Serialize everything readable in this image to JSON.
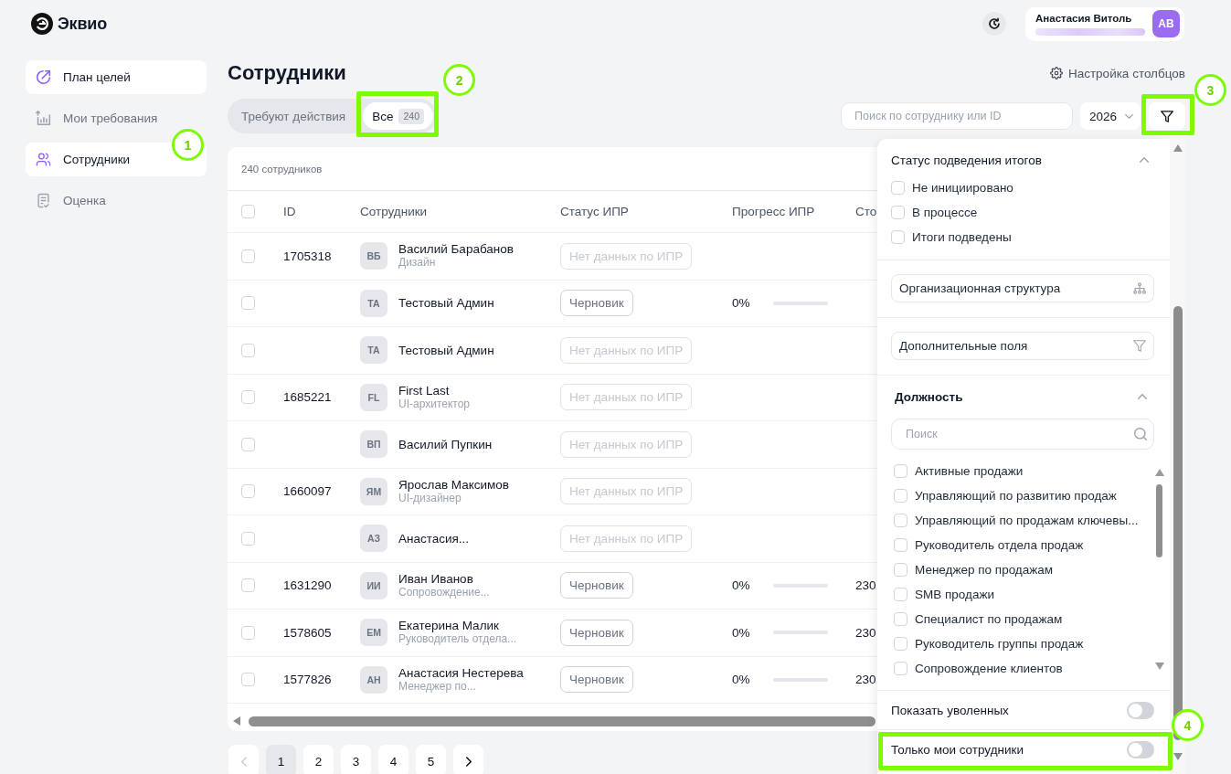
{
  "header": {
    "logo_text": "Эквио",
    "user": {
      "name": "Анастасия Витоль",
      "email_hidden": true,
      "initials": "АВ"
    }
  },
  "sidebar": {
    "items": [
      {
        "label": "План целей",
        "selected": true
      },
      {
        "label": "Мои требования",
        "selected": false
      },
      {
        "label": "Сотрудники",
        "selected": true,
        "marker": "1"
      },
      {
        "label": "Оценка",
        "selected": false
      }
    ]
  },
  "page": {
    "title": "Сотрудники",
    "columns_settings": "Настройка столбцов"
  },
  "tabs": [
    {
      "label": "Требуют действия",
      "selected": false,
      "highlighted": false
    },
    {
      "label": "Все",
      "count": "240",
      "selected": true,
      "highlighted": true,
      "marker": "2"
    }
  ],
  "search": {
    "placeholder": "Поиск по сотруднику или ID"
  },
  "year_select": {
    "value": "2026"
  },
  "filter_button": {
    "highlighted": true,
    "marker": "3"
  },
  "table": {
    "summary": "240 сотрудников",
    "select_all_checked": false,
    "columns": [
      "ID",
      "Сотрудники",
      "Статус ИПР",
      "Прогресс ИПР",
      "Сто"
    ],
    "rows": [
      {
        "checked": false,
        "id": "1705318",
        "initials": "ВБ",
        "name": "Василий Барабанов",
        "position": "Дизайн",
        "status": {
          "text": "Нет данных по ИПР",
          "kind": "empty"
        }
      },
      {
        "checked": false,
        "initials": "ТА",
        "name": "Тестовый Админ",
        "status": {
          "text": "Черновик",
          "kind": "draft"
        },
        "progress": {
          "text": "0%",
          "level": 0
        }
      },
      {
        "checked": false,
        "initials": "ТА",
        "name": "Тестовый Админ",
        "status": {
          "text": "Нет данных по ИПР",
          "kind": "empty"
        }
      },
      {
        "checked": false,
        "id": "1685221",
        "initials": "FL",
        "name": "First Last",
        "position": "UI-архитектор",
        "status": {
          "text": "Нет данных по ИПР",
          "kind": "empty"
        }
      },
      {
        "checked": false,
        "initials": "ВП",
        "name": "Василий Пупкин",
        "status": {
          "text": "Нет данных по ИПР",
          "kind": "empty"
        }
      },
      {
        "checked": false,
        "id": "1660097",
        "initials": "ЯМ",
        "name": "Ярослав Максимов",
        "position": "UI-дизайнер",
        "status": {
          "text": "Нет данных по ИПР",
          "kind": "empty"
        }
      },
      {
        "checked": false,
        "initials": "АЗ",
        "name": "Анастасия...",
        "status": {
          "text": "Нет данных по ИПР",
          "kind": "empty"
        }
      },
      {
        "checked": false,
        "id": "1631290",
        "initials": "ИИ",
        "name": "Иван Иванов",
        "position": "Сопровождение...",
        "status": {
          "text": "Черновик",
          "kind": "draft"
        },
        "progress": {
          "text": "0%",
          "level": 0
        },
        "column_5": "230"
      },
      {
        "checked": false,
        "id": "1578605",
        "initials": "ЕМ",
        "name": "Екатерина Малик",
        "position": "Руководитель отдела...",
        "status": {
          "text": "Черновик",
          "kind": "draft"
        },
        "progress": {
          "text": "0%",
          "level": 0
        },
        "column_5": "230"
      },
      {
        "checked": false,
        "id": "1577826",
        "initials": "АН",
        "name": "Анастасия Нестерева",
        "position": "Менеджер по...",
        "status": {
          "text": "Черновик",
          "kind": "draft"
        },
        "progress": {
          "text": "0%",
          "level": 0
        },
        "column_5": "230"
      }
    ]
  },
  "pagination": {
    "prev": {
      "disabled": true
    },
    "pages": [
      {
        "label": "1",
        "selected": true
      },
      {
        "label": "2",
        "selected": false
      },
      {
        "label": "3",
        "selected": false
      },
      {
        "label": "4",
        "selected": false
      },
      {
        "label": "5",
        "selected": false
      }
    ],
    "next": {
      "disabled": false
    }
  },
  "filter_panel": {
    "sections": [
      {
        "kind": "checklist",
        "title": "Статус подведения итогов",
        "expanded": true,
        "options": [
          {
            "label": "Не инициировано",
            "checked": false
          },
          {
            "label": "В процессе",
            "checked": false
          },
          {
            "label": "Итоги подведены",
            "checked": false
          }
        ]
      },
      {
        "kind": "picker",
        "label": "Организационная структура"
      },
      {
        "kind": "picker",
        "label": "Дополнительные поля"
      },
      {
        "kind": "searchlist",
        "title": "Должность",
        "expanded": true,
        "search_placeholder": "Поиск",
        "options": [
          {
            "label": "Активные продажи",
            "checked": false
          },
          {
            "label": "Управляющий по развитию продаж",
            "checked": false
          },
          {
            "label": "Управляющий по продажам ключевы...",
            "checked": false
          },
          {
            "label": "Руководитель отдела продаж",
            "checked": false
          },
          {
            "label": "Менеджер по продажам",
            "checked": false
          },
          {
            "label": "SMB продажи",
            "checked": false
          },
          {
            "label": "Специалист по продажам",
            "checked": false
          },
          {
            "label": "Руководитель группы продаж",
            "checked": false
          },
          {
            "label": "Сопровождение клиентов",
            "checked": false
          }
        ]
      }
    ],
    "toggles": [
      {
        "label": "Показать уволенных",
        "on": false,
        "highlighted": false
      },
      {
        "label": "Только мои сотрудники",
        "on": false,
        "highlighted": true,
        "marker": "4"
      }
    ]
  }
}
